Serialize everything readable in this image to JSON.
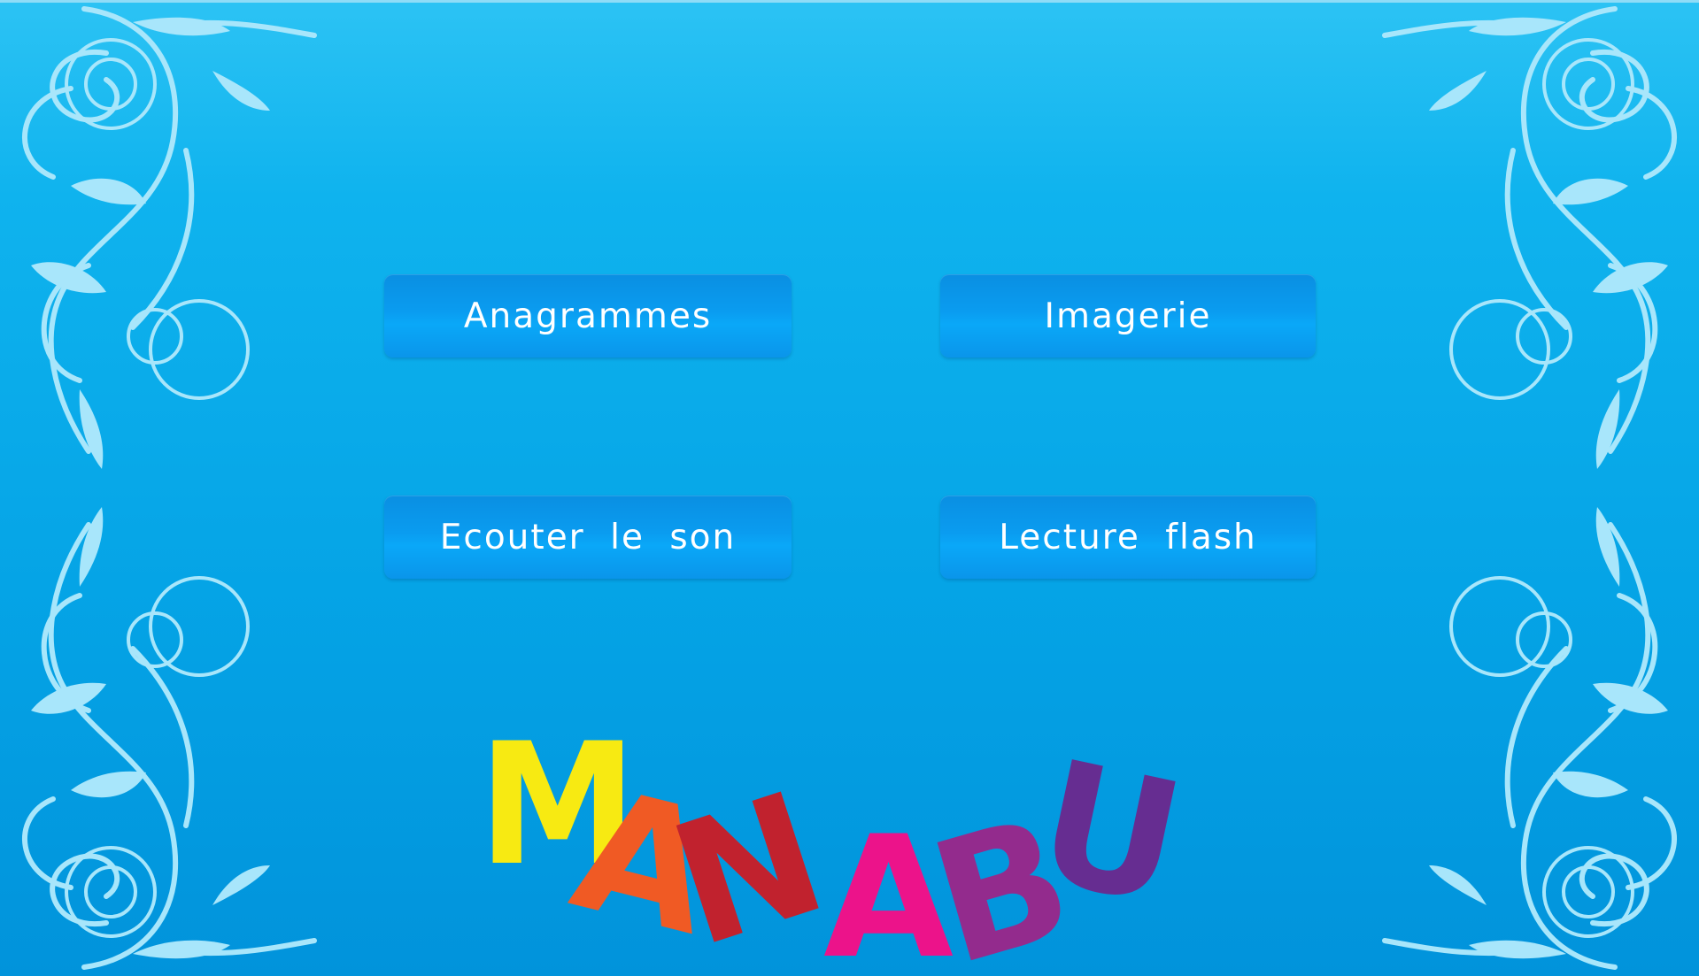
{
  "menu": {
    "buttons": [
      {
        "label": "Anagrammes"
      },
      {
        "label": "Imagerie"
      },
      {
        "label": "Ecouter le son"
      },
      {
        "label": "Lecture flash"
      }
    ]
  },
  "logo": {
    "text": "MANABU",
    "letters": [
      {
        "char": "M",
        "color": "#f7ea12"
      },
      {
        "char": "A",
        "color": "#f05a24"
      },
      {
        "char": "N",
        "color": "#c1222e"
      },
      {
        "char": "A",
        "color": "#ec138a"
      },
      {
        "char": "B",
        "color": "#932b8d"
      },
      {
        "char": "U",
        "color": "#662d91"
      }
    ]
  },
  "colors": {
    "background_top": "#2cc3f4",
    "background_bottom": "#0193db",
    "button": "#0a9cf0",
    "ornament": "#a8e6fb"
  },
  "icons": [
    "floral-ornament-icon"
  ]
}
